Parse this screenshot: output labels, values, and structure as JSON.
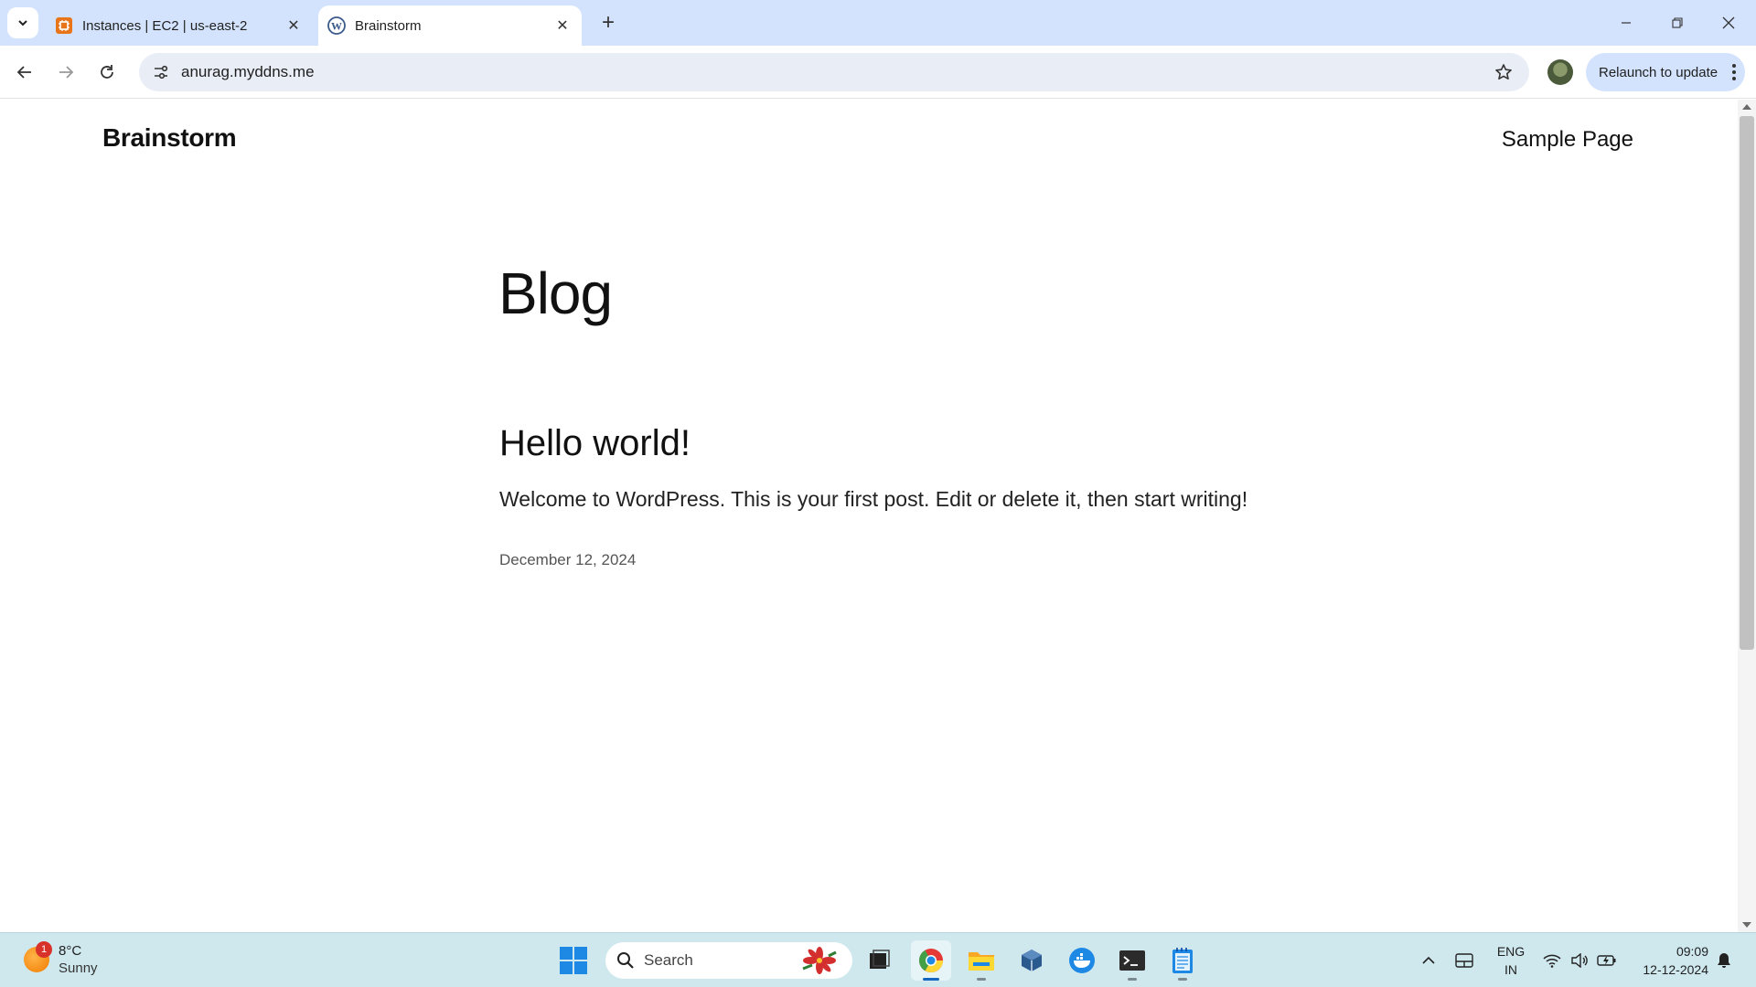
{
  "browser": {
    "tabs": [
      {
        "title": "Instances | EC2 | us-east-2",
        "icon": "aws-ec2-icon",
        "active": false
      },
      {
        "title": "Brainstorm",
        "icon": "wordpress-icon",
        "active": true
      }
    ],
    "url": "anurag.myddns.me",
    "relaunch_label": "Relaunch to update"
  },
  "site": {
    "title": "Brainstorm",
    "nav": {
      "sample_page": "Sample Page"
    },
    "heading": "Blog",
    "post": {
      "title": "Hello world!",
      "excerpt": "Welcome to WordPress. This is your first post. Edit or delete it, then start writing!",
      "date": "December 12, 2024"
    }
  },
  "taskbar": {
    "weather": {
      "temp": "8°C",
      "condition": "Sunny",
      "badge": "1"
    },
    "search_placeholder": "Search",
    "language": {
      "line1": "ENG",
      "line2": "IN"
    },
    "time": "09:09",
    "date": "12-12-2024"
  },
  "colors": {
    "tabstrip": "#d3e3fd",
    "omnibox": "#e9eef6",
    "taskbar": "#cfe8ee",
    "accent": "#1e88e5"
  }
}
